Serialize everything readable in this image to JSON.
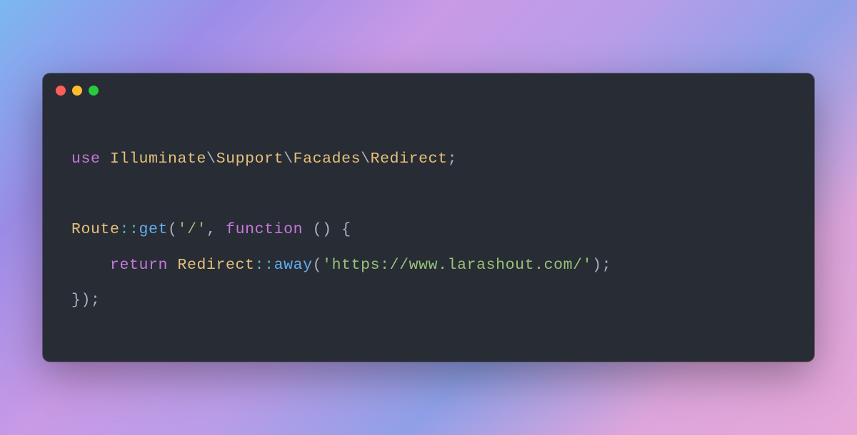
{
  "window": {
    "traffic_lights": [
      "close",
      "minimize",
      "zoom"
    ]
  },
  "code": {
    "lines": [
      [
        {
          "t": "use ",
          "c": "tok-kw"
        },
        {
          "t": "Illuminate",
          "c": "tok-cls"
        },
        {
          "t": "\\",
          "c": "tok-punc"
        },
        {
          "t": "Support",
          "c": "tok-cls"
        },
        {
          "t": "\\",
          "c": "tok-punc"
        },
        {
          "t": "Facades",
          "c": "tok-cls"
        },
        {
          "t": "\\",
          "c": "tok-punc"
        },
        {
          "t": "Redirect",
          "c": "tok-cls"
        },
        {
          "t": ";",
          "c": "tok-punc"
        }
      ],
      [],
      [
        {
          "t": "Route",
          "c": "tok-cls"
        },
        {
          "t": "::",
          "c": "tok-op"
        },
        {
          "t": "get",
          "c": "tok-fn"
        },
        {
          "t": "(",
          "c": "tok-punc"
        },
        {
          "t": "'/'",
          "c": "tok-str"
        },
        {
          "t": ", ",
          "c": "tok-punc"
        },
        {
          "t": "function ",
          "c": "tok-kw"
        },
        {
          "t": "() {",
          "c": "tok-punc"
        }
      ],
      [
        {
          "t": "    ",
          "c": "tok-punc"
        },
        {
          "t": "return ",
          "c": "tok-kw"
        },
        {
          "t": "Redirect",
          "c": "tok-cls"
        },
        {
          "t": "::",
          "c": "tok-op"
        },
        {
          "t": "away",
          "c": "tok-fn"
        },
        {
          "t": "(",
          "c": "tok-punc"
        },
        {
          "t": "'https://www.larashout.com/'",
          "c": "tok-str"
        },
        {
          "t": ");",
          "c": "tok-punc"
        }
      ],
      [
        {
          "t": "});",
          "c": "tok-punc"
        }
      ]
    ]
  }
}
